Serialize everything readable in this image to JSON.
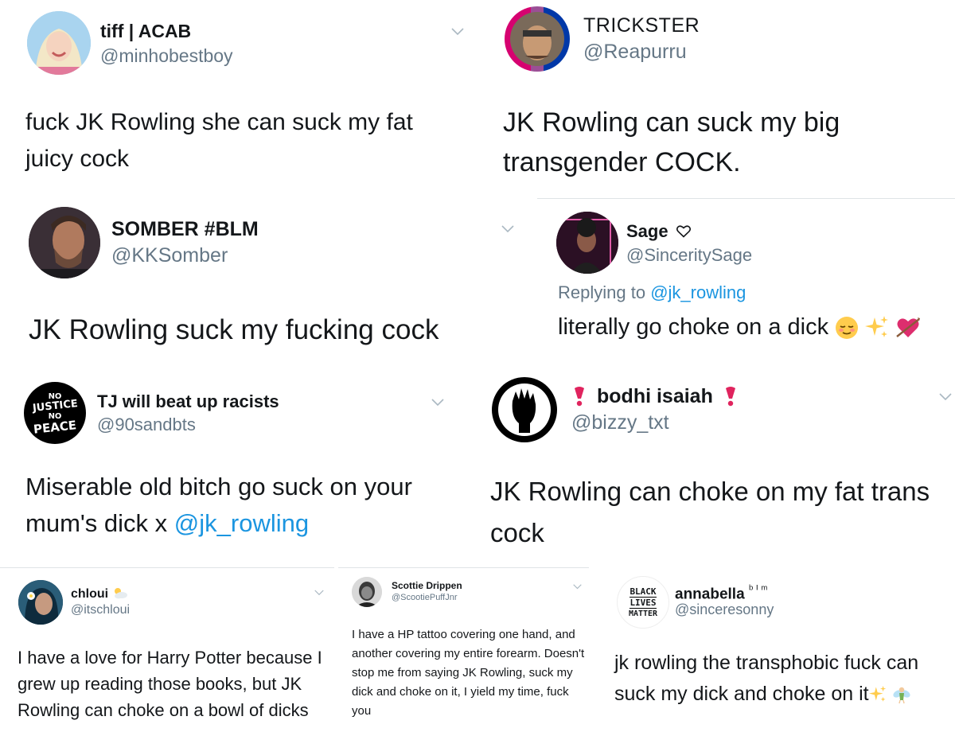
{
  "tweets": [
    {
      "name": "tiff | ACAB",
      "handle": "@minhobestboy",
      "text": "fuck JK Rowling she can suck my fat juicy cock"
    },
    {
      "name": "TRICKSTER",
      "handle": "@Reapurru",
      "text": "JK Rowling can suck my big transgender COCK."
    },
    {
      "name": "SOMBER #BLM",
      "handle": "@KKSomber",
      "text": "JK Rowling suck my fucking cock"
    },
    {
      "name": "Sage",
      "handle": "@SinceritySage",
      "reply_prefix": "Replying to",
      "reply_to": "@jk_rowling",
      "text": "literally go choke on a dick"
    },
    {
      "name": "TJ will beat up racists",
      "handle": "@90sandbts",
      "text": "Miserable old bitch go suck on your mum's dick x",
      "mention": "@jk_rowling"
    },
    {
      "name": "bodhi isaiah",
      "handle": "@bizzy_txt",
      "text": "JK Rowling can choke on my fat trans cock"
    },
    {
      "name": "chloui",
      "handle": "@itschloui",
      "text": "I have a love for Harry Potter because I grew up reading those books, but JK Rowling can choke on a bowl of dicks"
    },
    {
      "name": "Scottie Drippen",
      "handle": "@ScootiePuffJnr",
      "text": "I have a HP tattoo covering one hand, and another covering my entire forearm. Doesn't stop me from saying JK Rowling, suck my dick and choke on it, I yield my time, fuck you"
    },
    {
      "name": "annabella",
      "name_suffix": "ᵇ ᴵ ᵐ",
      "handle": "@sinceresonny",
      "text": "jk rowling the transphobic fuck can suck my dick and choke on it"
    }
  ],
  "avatars": {
    "tj_text_1": "NO",
    "tj_text_2": "JUSTICE",
    "tj_text_3": "NO",
    "tj_text_4": "PEACE",
    "blm_1": "BLACK",
    "blm_2": "LIVES",
    "blm_3": "MATTER"
  },
  "icons": {
    "chevron": "chevron-down-icon",
    "sage_heart": "heart-outline-icon",
    "relieved": "relieved-face-emoji",
    "sparkles": "sparkles-emoji",
    "arrow_heart": "heart-with-arrow-emoji",
    "exclamation": "red-heavy-exclamation-emoji",
    "cloud_sun": "sun-behind-cloud-emoji",
    "fairy": "fairy-emoji"
  },
  "colors": {
    "text": "#14171a",
    "muted": "#657786",
    "link": "#1b95e0",
    "divider": "#dfe3e6",
    "exclaim": "#e0245e"
  }
}
